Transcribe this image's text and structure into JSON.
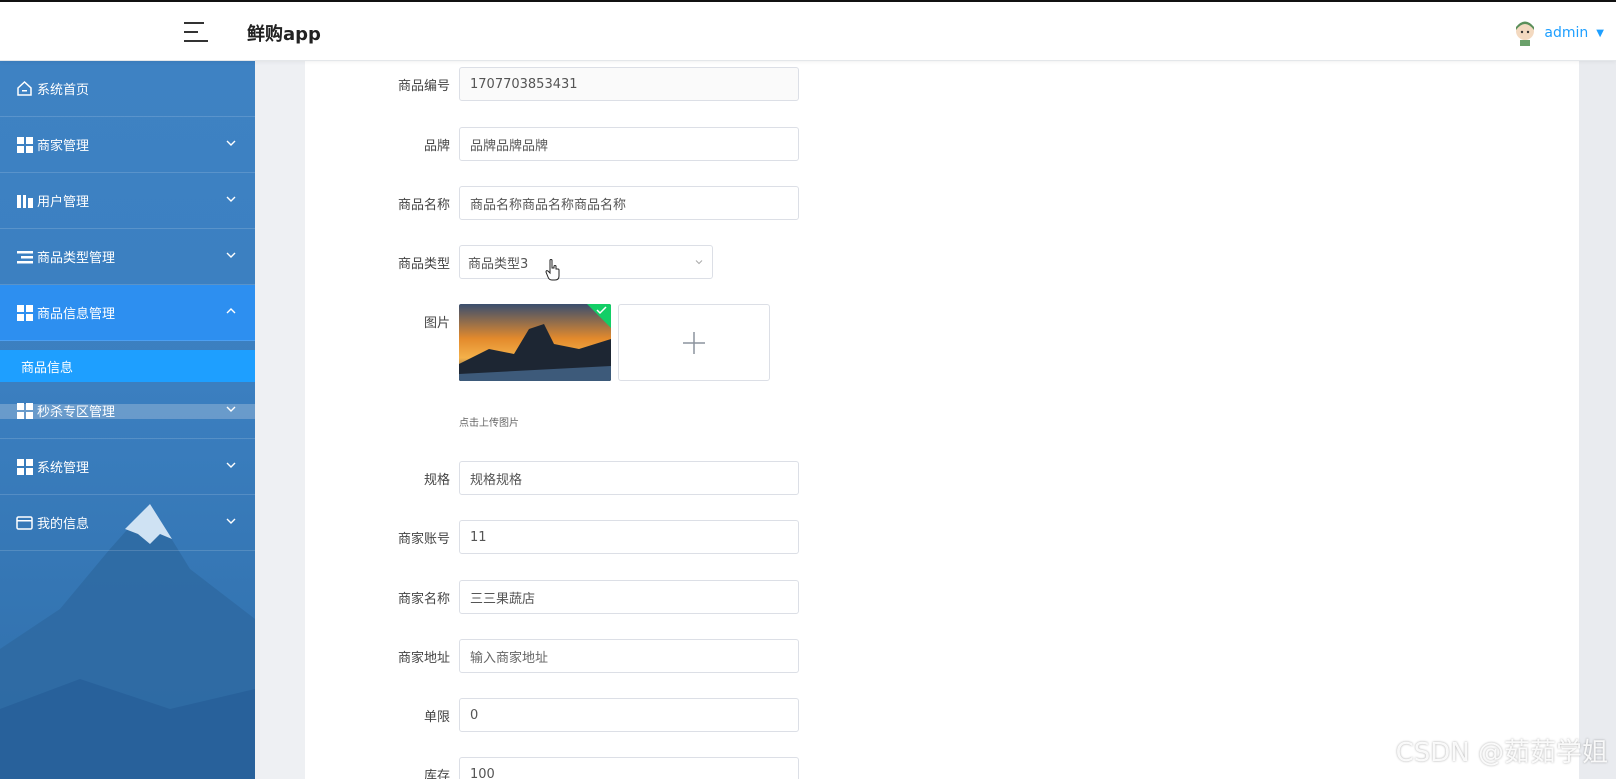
{
  "header": {
    "app_title": "鲜购app",
    "user_name": "admin"
  },
  "sidebar": {
    "items": [
      {
        "label": "系统首页",
        "icon": "home-icon"
      },
      {
        "label": "商家管理",
        "icon": "grid-icon"
      },
      {
        "label": "用户管理",
        "icon": "bar-icon"
      },
      {
        "label": "商品类型管理",
        "icon": "list-icon"
      },
      {
        "label": "商品信息管理",
        "icon": "grid-icon",
        "expanded": true
      },
      {
        "label": "秒杀专区管理",
        "icon": "grid-icon"
      },
      {
        "label": "系统管理",
        "icon": "grid-icon"
      },
      {
        "label": "我的信息",
        "icon": "card-icon"
      }
    ],
    "submenu": {
      "label": "商品信息"
    }
  },
  "form": {
    "product_no": {
      "label": "商品编号",
      "value": "1707703853431"
    },
    "brand": {
      "label": "品牌",
      "value": "品牌品牌品牌"
    },
    "product_name": {
      "label": "商品名称",
      "value": "商品名称商品名称商品名称"
    },
    "product_type": {
      "label": "商品类型",
      "value": "商品类型3"
    },
    "image": {
      "label": "图片",
      "tip": "点击上传图片"
    },
    "spec": {
      "label": "规格",
      "value": "规格规格"
    },
    "merchant_account": {
      "label": "商家账号",
      "value": "11"
    },
    "merchant_name": {
      "label": "商家名称",
      "value": "三三果蔬店"
    },
    "merchant_address": {
      "label": "商家地址",
      "placeholder": "输入商家地址"
    },
    "limit": {
      "label": "单限",
      "value": "0"
    },
    "stock": {
      "label": "库存",
      "value": "100"
    }
  },
  "watermark": "CSDN @茹茹学姐",
  "colors": {
    "accent": "#1e9fff",
    "sidebar": "#3b7fc0",
    "active_menu": "#2d8ff0"
  }
}
